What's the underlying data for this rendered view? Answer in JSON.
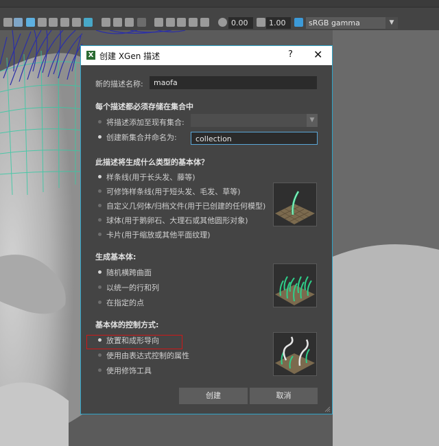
{
  "toolbar": {
    "exposure_value": "0.00",
    "gamma_value": "1.00",
    "colorspace": "sRGB gamma"
  },
  "dialog": {
    "title": "创建 XGen 描述",
    "help_label": "?",
    "close_label": "✕",
    "name_label": "新的描述名称:",
    "name_value": "maofa",
    "collection_section": "每个描述都必须存储在集合中",
    "add_existing_label": "将描述添加至现有集合:",
    "create_new_label": "创建新集合并命名为:",
    "collection_value": "collection",
    "primitive_section": "此描述将生成什么类型的基本体？",
    "primitive_options": [
      "样条线(用于长头发、藤等)",
      "可修饰样条线(用于短头发、毛发、草等)",
      "自定义几何体/归档文件(用于已创建的任何模型)",
      "球体(用于鹅卵石、大理石或其他圆形对象)",
      "卡片(用于缩放或其他平面纹理)"
    ],
    "generate_section": "生成基本体:",
    "generate_options": [
      "随机横跨曲面",
      "以统一的行和列",
      "在指定的点"
    ],
    "control_section": "基本体的控制方式:",
    "control_options": [
      "放置和成形导向",
      "使用由表达式控制的属性",
      "使用修饰工具"
    ],
    "create_button": "创建",
    "cancel_button": "取消"
  }
}
